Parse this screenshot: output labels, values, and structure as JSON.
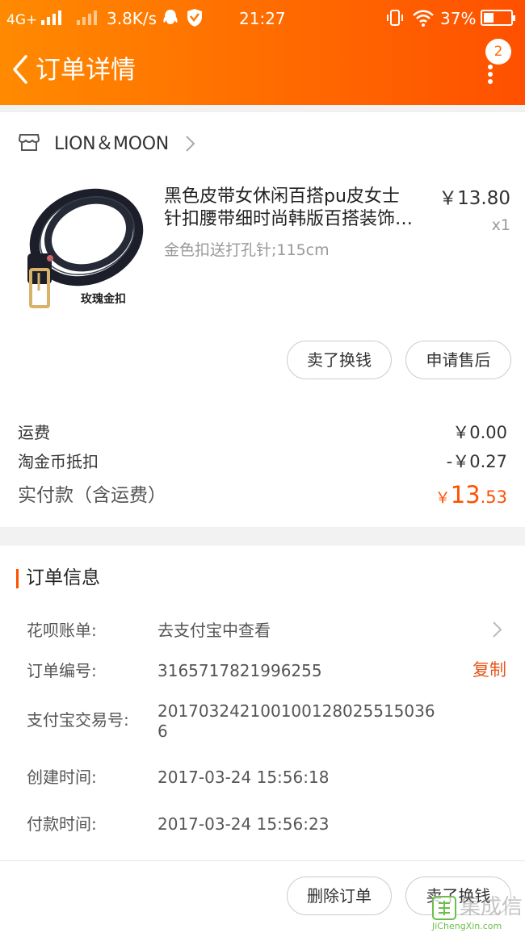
{
  "status_bar": {
    "network": "4G+",
    "speed": "3.8K/s",
    "time": "21:27",
    "battery": "37%",
    "battery_level": 0.37
  },
  "header": {
    "title": "订单详情",
    "badge_count": "2",
    "icons": [
      "back-arrow-icon",
      "more-vertical-icon"
    ]
  },
  "store": {
    "name": "LION＆MOON"
  },
  "product": {
    "title_line1": "黑色皮带女休闲百搭pu皮女士",
    "title_line2": "针扣腰带细时尚韩版百搭装饰…",
    "spec": "金色扣送打孔针;115cm",
    "price": "￥13.80",
    "quantity": "x1",
    "image_caption": "玫瑰金扣"
  },
  "item_actions": {
    "sell_label": "卖了换钱",
    "after_sale_label": "申请售后"
  },
  "summary": {
    "shipping_label": "运费",
    "shipping_value": "￥0.00",
    "coin_label": "淘金币抵扣",
    "coin_value": "-￥0.27",
    "total_label": "实付款（含运费）",
    "total_currency": "￥",
    "total_integer": "13",
    "total_decimal": ".53"
  },
  "order_info": {
    "section_title": "订单信息",
    "huabei_label": "花呗账单:",
    "huabei_value": "去支付宝中查看",
    "order_no_label": "订单编号:",
    "order_no_value": "3165717821996255",
    "copy_label": "复制",
    "alipay_label": "支付宝交易号:",
    "alipay_value_line1": "201703242100100128025515036",
    "alipay_value_line2": "6",
    "created_label": "创建时间:",
    "created_value": "2017-03-24 15:56:18",
    "paid_label": "付款时间:",
    "paid_value": "2017-03-24 15:56:23"
  },
  "footer": {
    "delete_label": "删除订单",
    "sell_label": "卖了换钱"
  },
  "watermark": {
    "text_cn": "集成信",
    "text_en": "JiChengXin.com"
  },
  "colors": {
    "accent": "#ff5000",
    "header_start": "#ff8a00",
    "header_end": "#ff5000",
    "copy_text": "#e8561c"
  }
}
